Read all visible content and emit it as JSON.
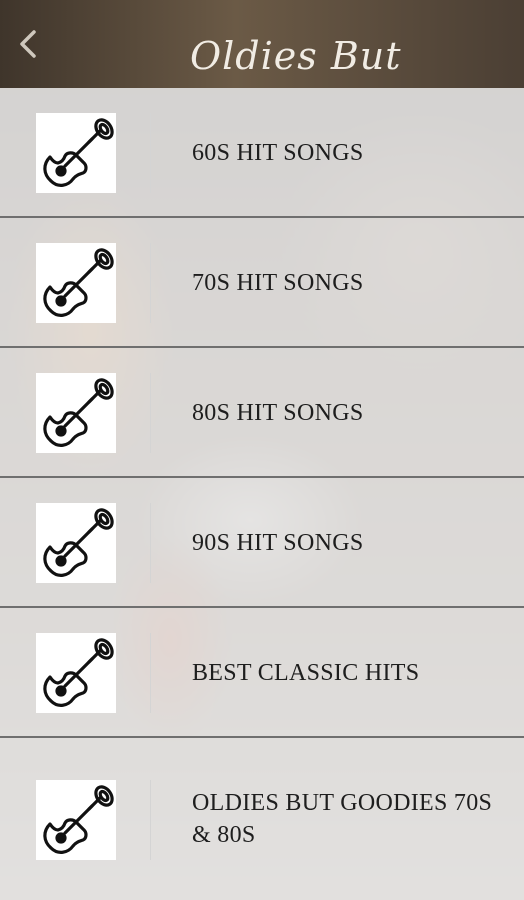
{
  "header": {
    "title": "Oldies But",
    "back_icon": "chevron-left-icon"
  },
  "menu": {
    "items": [
      {
        "label": "60S HIT SONGS",
        "icon": "guitar-icon"
      },
      {
        "label": "70S HIT SONGS",
        "icon": "guitar-icon"
      },
      {
        "label": "80S HIT SONGS",
        "icon": "guitar-icon"
      },
      {
        "label": "90S HIT SONGS",
        "icon": "guitar-icon"
      },
      {
        "label": "BEST CLASSIC HITS",
        "icon": "guitar-icon"
      },
      {
        "label": "OLDIES BUT GOODIES 70S & 80S",
        "icon": "guitar-icon"
      }
    ]
  },
  "colors": {
    "row_background": "#e8e8e8",
    "row_border": "#6f6f6f",
    "header_text": "#f1ece4"
  }
}
